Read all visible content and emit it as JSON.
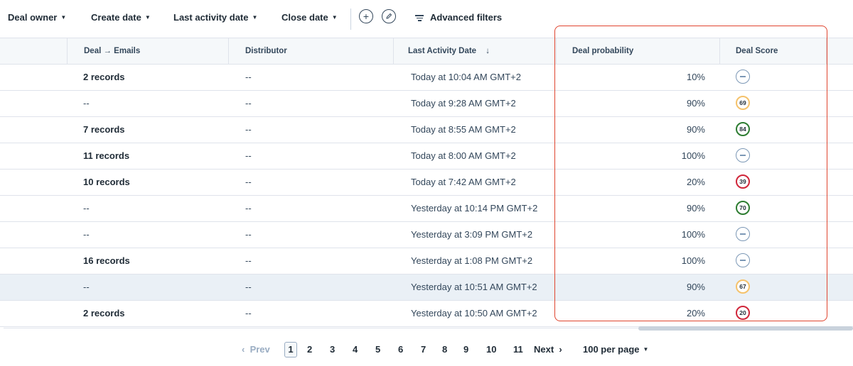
{
  "filters": {
    "deal_owner": "Deal owner",
    "create_date": "Create date",
    "last_activity_date": "Last activity date",
    "close_date": "Close date",
    "advanced": "Advanced filters"
  },
  "table": {
    "headers": {
      "deal_emails": "Deal → Emails",
      "distributor": "Distributor",
      "last_activity": "Last Activity Date",
      "sort_arrow": "↓",
      "probability": "Deal probability",
      "score": "Deal Score"
    },
    "rows": [
      {
        "deal": "2 records",
        "distributor": "--",
        "activity": "Today at 10:04 AM GMT+2",
        "probability": "10%",
        "score": "",
        "score_color": "none"
      },
      {
        "deal": "--",
        "distributor": "--",
        "activity": "Today at 9:28 AM GMT+2",
        "probability": "90%",
        "score": "69",
        "score_color": "#f5c26b"
      },
      {
        "deal": "7 records",
        "distributor": "--",
        "activity": "Today at 8:55 AM GMT+2",
        "probability": "90%",
        "score": "84",
        "score_color": "#2e7d32"
      },
      {
        "deal": "11 records",
        "distributor": "--",
        "activity": "Today at 8:00 AM GMT+2",
        "probability": "100%",
        "score": "",
        "score_color": "none"
      },
      {
        "deal": "10 records",
        "distributor": "--",
        "activity": "Today at 7:42 AM GMT+2",
        "probability": "20%",
        "score": "39",
        "score_color": "#d0263a"
      },
      {
        "deal": "--",
        "distributor": "--",
        "activity": "Yesterday at 10:14 PM GMT+2",
        "probability": "90%",
        "score": "70",
        "score_color": "#2e7d32"
      },
      {
        "deal": "--",
        "distributor": "--",
        "activity": "Yesterday at 3:09 PM GMT+2",
        "probability": "100%",
        "score": "",
        "score_color": "none"
      },
      {
        "deal": "16 records",
        "distributor": "--",
        "activity": "Yesterday at 1:08 PM GMT+2",
        "probability": "100%",
        "score": "",
        "score_color": "none"
      },
      {
        "deal": "--",
        "distributor": "--",
        "activity": "Yesterday at 10:51 AM GMT+2",
        "probability": "90%",
        "score": "67",
        "score_color": "#f5c26b"
      },
      {
        "deal": "2 records",
        "distributor": "--",
        "activity": "Yesterday at 10:50 AM GMT+2",
        "probability": "20%",
        "score": "20",
        "score_color": "#d0263a"
      }
    ]
  },
  "pagination": {
    "prev": "Prev",
    "next": "Next",
    "pages": [
      "1",
      "2",
      "3",
      "4",
      "5",
      "6",
      "7",
      "8",
      "9",
      "10",
      "11"
    ],
    "current": "1",
    "per_page": "100 per page"
  },
  "colors": {
    "highlight": "#e0452f",
    "hover_row": "#eaf0f6"
  }
}
